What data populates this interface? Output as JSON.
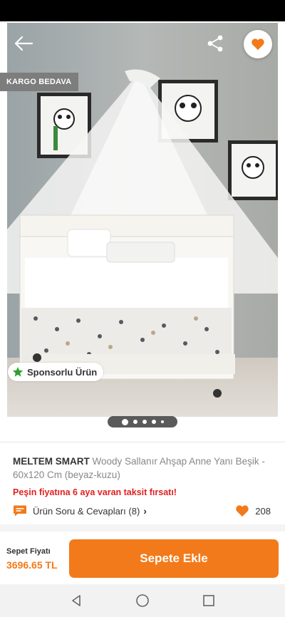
{
  "badges": {
    "shipping": "KARGO BEDAVA",
    "sponsored": "Sponsorlu Ürün"
  },
  "product": {
    "brand": "MELTEM SMART",
    "name": "Woody Sallanır Ahşap Anne Yanı Beşik - 60x120 Cm (beyaz-kuzu)",
    "promo": "Peşin fiyatına 6 aya varan taksit fırsatı!",
    "qa_label": "Ürün Soru & Cevapları (8)",
    "favorite_count": "208"
  },
  "carousel": {
    "total_dots": 5,
    "active_index": 0
  },
  "cart": {
    "price_label": "Sepet Fiyatı",
    "price": "3696.65 TL",
    "add_button": "Sepete Ekle"
  },
  "icons": [
    "back-arrow-icon",
    "share-icon",
    "heart-icon",
    "star-icon",
    "qa-chat-icon",
    "chevron-right-icon",
    "nav-back-icon",
    "nav-home-icon",
    "nav-recents-icon"
  ],
  "colors": {
    "accent": "#f27a1a",
    "promo": "#e02020",
    "sponsor_star": "#2ca02c"
  }
}
